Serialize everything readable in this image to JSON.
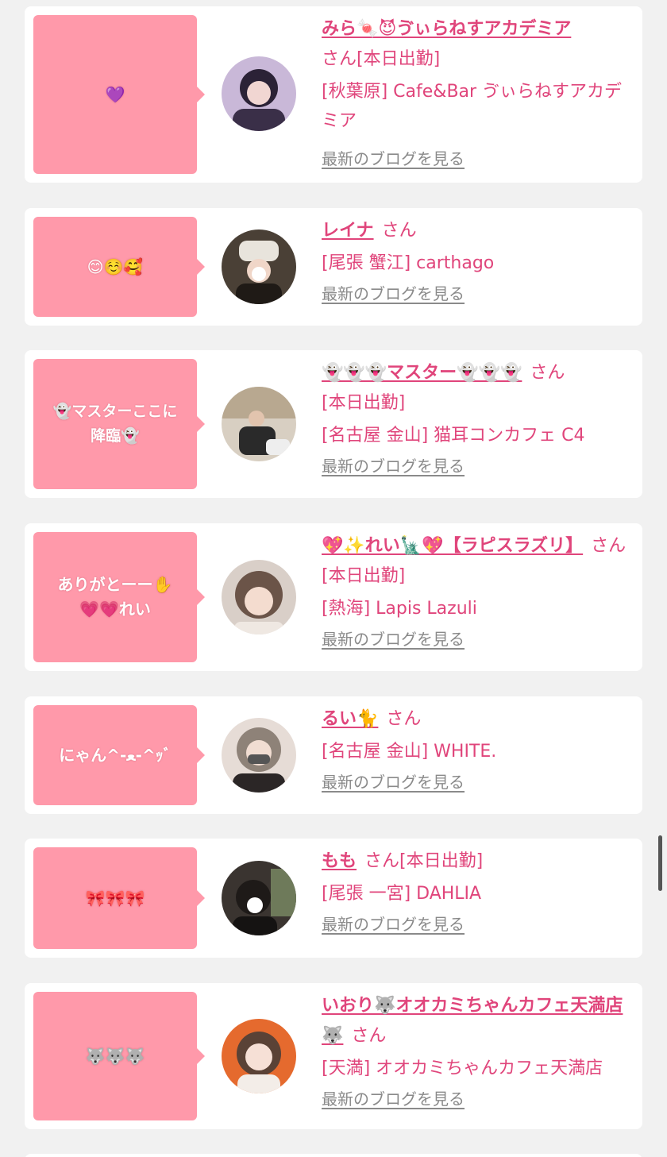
{
  "blog_link_label": "最新のブログを見る",
  "san_label": "さん",
  "colors": {
    "background": "#f1f1f1",
    "bubble": "#ff99aa",
    "name_text": "#e0457b",
    "link_gray": "#8a8a8a"
  },
  "cast": [
    {
      "bubble": "💜",
      "name": "みら🍬😈ゔぃらねすアカデミア",
      "suffix": "さん[本日出勤]",
      "shop": "[秋葉原] Cafe&Bar ゔぃらねすアカデミア",
      "avatar_icon": "cast-photo-icon"
    },
    {
      "bubble": "😊☺️🥰",
      "name": "レイナ",
      "suffix": "さん",
      "shop": "[尾張 蟹江] carthago",
      "avatar_icon": "cast-photo-icon"
    },
    {
      "bubble": "👻マスターここに\n降臨👻",
      "name": "👻👻👻マスター👻👻👻",
      "suffix": "さん",
      "status": "[本日出勤]",
      "shop": "[名古屋 金山] 猫耳コンカフェ C4",
      "avatar_icon": "cast-photo-icon"
    },
    {
      "bubble": "ありがとーー✋\n💗💗れい",
      "name": "💖✨れい🗽💖【ラピスラズリ】",
      "suffix": "さん[本日出勤]",
      "shop": "[熱海] Lapis Lazuli",
      "avatar_icon": "cast-photo-icon"
    },
    {
      "bubble": "にゃん^-ﻌ-^ｯﾞ",
      "name": "るい🐈",
      "suffix": "さん",
      "shop": "[名古屋 金山] WHITE.",
      "avatar_icon": "cast-photo-icon"
    },
    {
      "bubble": "🎀🎀🎀",
      "name": "もも",
      "suffix": "さん[本日出勤]",
      "shop": "[尾張 一宮] DAHLIA",
      "avatar_icon": "cast-photo-icon"
    },
    {
      "bubble": "🐺🐺🐺",
      "name": "いおり🐺オオカミちゃんカフェ天満店🐺",
      "suffix": "さん",
      "shop": "[天満] オオカミちゃんカフェ天満店",
      "avatar_icon": "cast-photo-icon"
    }
  ]
}
